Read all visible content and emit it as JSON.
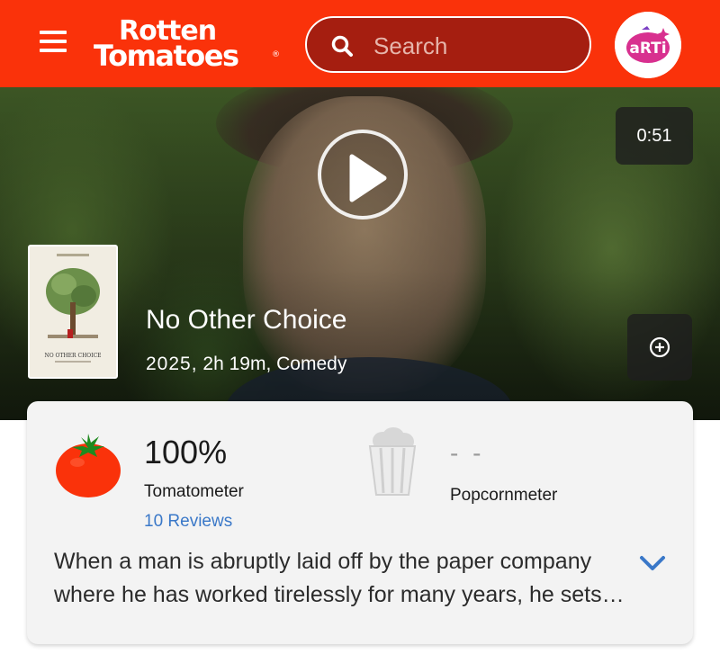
{
  "header": {
    "logo_line1": "Rotten",
    "logo_line2": "Tomatoes",
    "logo_reg": "®",
    "search_placeholder": "Search",
    "avatar_text": "aRTi",
    "brand_color": "#fa320a",
    "search_bg_color": "#a51e10",
    "icons": {
      "menu": "hamburger-menu-icon",
      "search": "search-icon"
    }
  },
  "hero": {
    "duration": "0:51",
    "title": "No Other Choice",
    "year": "2025,",
    "runtime": "2h 19m,",
    "genre": "Comedy",
    "poster_title": "NO OTHER CHOICE",
    "icons": {
      "play": "play-icon",
      "add": "add-circle-icon"
    }
  },
  "scores": {
    "tomatometer": {
      "score": "100%",
      "label": "Tomatometer",
      "reviews": "10 Reviews",
      "icon": "fresh-tomato-icon",
      "link_color": "#3a78c8"
    },
    "popcornmeter": {
      "score": "- -",
      "label": "Popcornmeter",
      "icon": "empty-popcorn-bucket-icon"
    }
  },
  "synopsis": {
    "text": "When a man is abruptly laid off by the paper company where he has worked tirelessly for many years, he sets out to secure a new job at any cost.",
    "expand_icon": "chevron-down-icon",
    "expand_color": "#3a78c8"
  }
}
